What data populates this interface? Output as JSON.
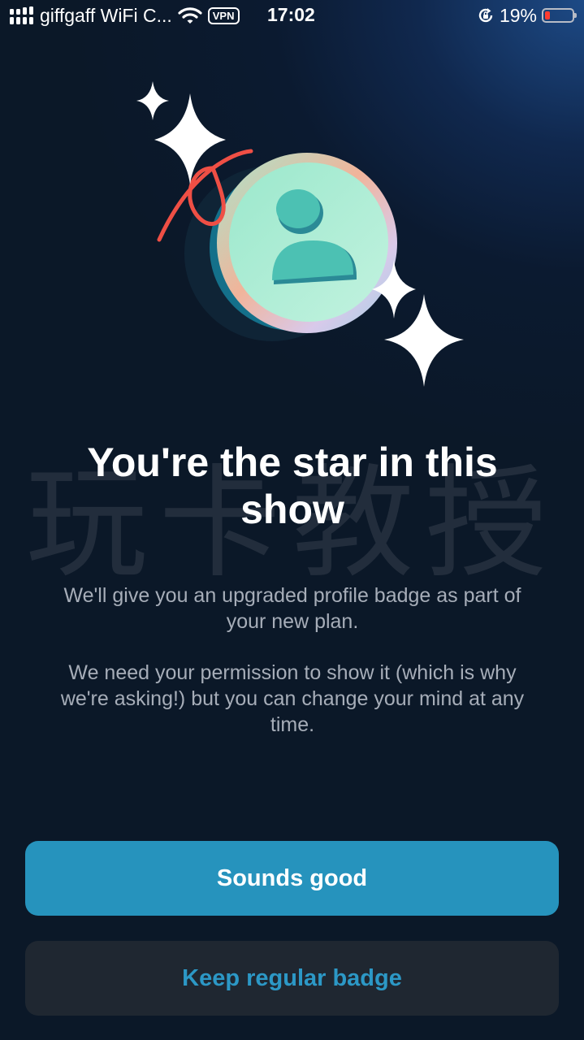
{
  "status_bar": {
    "carrier": "giffgaff WiFi C...",
    "vpn": "VPN",
    "time": "17:02",
    "battery_percent_label": "19%",
    "battery_level": 0.19,
    "icons": [
      "signal-icon",
      "wifi-icon",
      "rotation-lock-icon",
      "battery-icon"
    ]
  },
  "hero": {
    "icons": [
      "sparkle-icon",
      "profile-badge-icon",
      "ribbon-icon"
    ]
  },
  "content": {
    "title": "You're the star in this show",
    "paragraph_1": "We'll give you an upgraded profile badge as part of your new plan.",
    "paragraph_2": "We need your permission to show it (which is why we're asking!) but you can change your mind at any time."
  },
  "watermark": "玩卡教授",
  "actions": {
    "primary_label": "Sounds good",
    "secondary_label": "Keep regular badge"
  },
  "colors": {
    "primary_button": "#2693bd",
    "secondary_button": "#1f2731",
    "secondary_text": "#2c98c6",
    "ribbon": "#ef4f45",
    "battery_low": "#ff3b30"
  }
}
